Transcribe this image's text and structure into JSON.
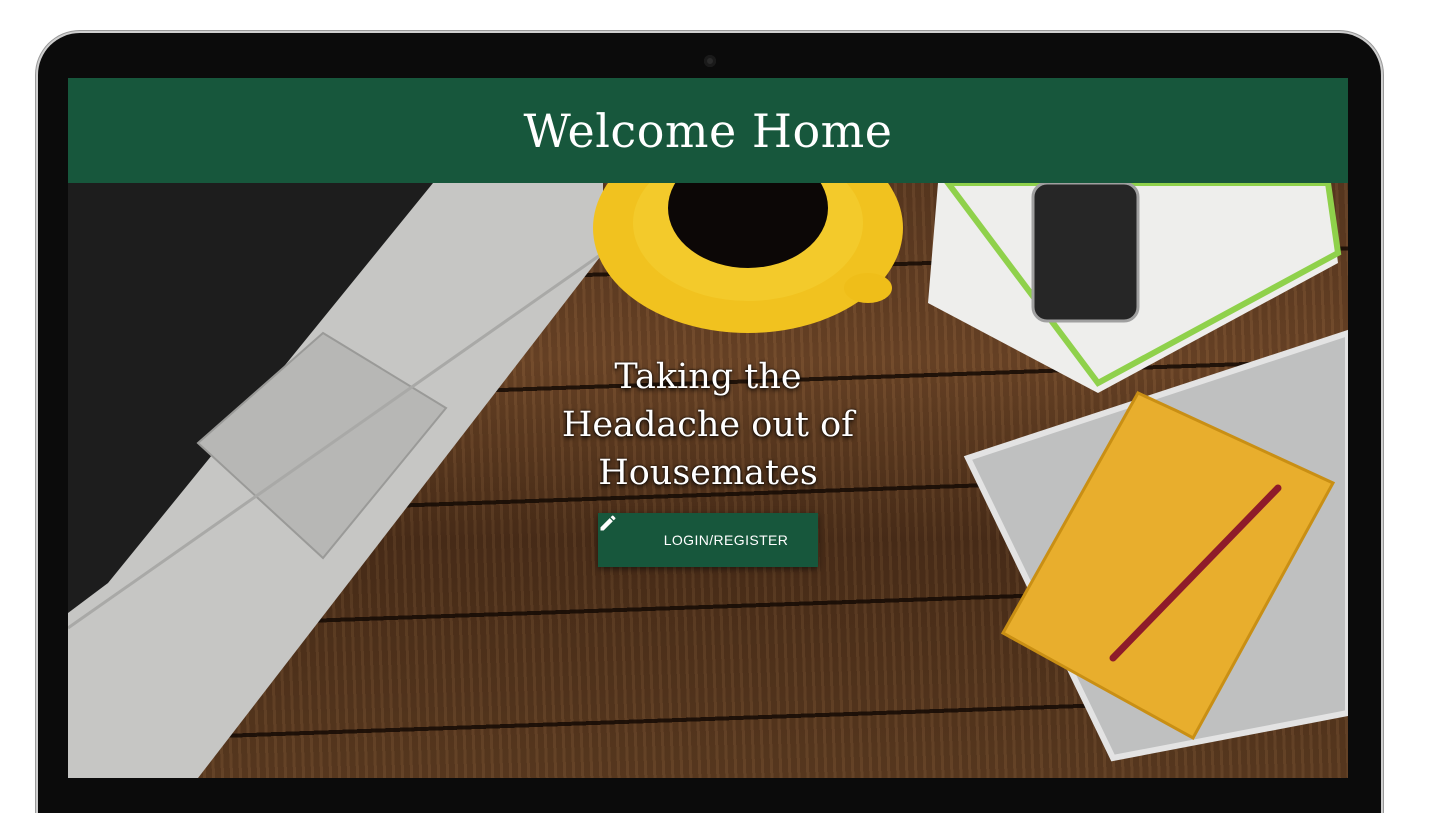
{
  "header": {
    "title": "Welcome Home"
  },
  "hero": {
    "tagline_line1": "Taking the",
    "tagline_line2": "Headache out of",
    "tagline_line3": "Housemates",
    "login_button_label": "LOGIN/REGISTER",
    "login_button_icon": "pencil-icon"
  },
  "colors": {
    "brand_green": "#17573c",
    "header_text": "#ffffff"
  }
}
